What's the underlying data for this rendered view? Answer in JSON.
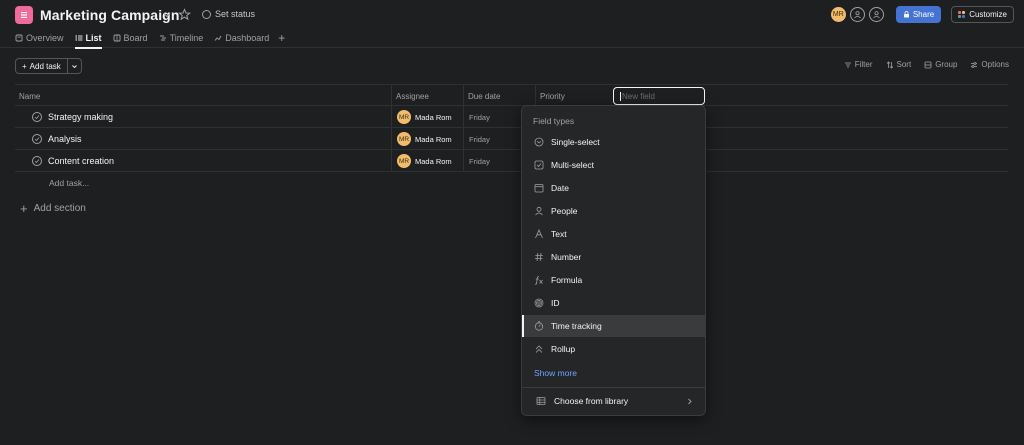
{
  "project": {
    "title": "Marketing Campaign",
    "set_status": "Set status",
    "icon": "list-icon",
    "icon_color": "#f06a9a"
  },
  "tabs": [
    {
      "label": "Overview",
      "icon": "overview-icon"
    },
    {
      "label": "List",
      "icon": "list-icon",
      "active": true
    },
    {
      "label": "Board",
      "icon": "board-icon"
    },
    {
      "label": "Timeline",
      "icon": "timeline-icon"
    },
    {
      "label": "Dashboard",
      "icon": "dashboard-icon"
    }
  ],
  "header_right": {
    "avatar_initials": "MR",
    "share_label": "Share",
    "customize_label": "Customize",
    "accent": "#4573d2"
  },
  "toolbar": {
    "add_task_label": "Add task",
    "filter_label": "Filter",
    "sort_label": "Sort",
    "group_label": "Group",
    "options_label": "Options"
  },
  "table": {
    "columns": [
      "Name",
      "Assignee",
      "Due date",
      "Priority"
    ],
    "new_field_placeholder": "New field",
    "rows": [
      {
        "name": "Strategy making",
        "assignee_initials": "MR",
        "assignee": "Mada Rom",
        "due": "Friday"
      },
      {
        "name": "Analysis",
        "assignee_initials": "MR",
        "assignee": "Mada Rom",
        "due": "Friday"
      },
      {
        "name": "Content creation",
        "assignee_initials": "MR",
        "assignee": "Mada Rom",
        "due": "Friday"
      }
    ],
    "add_task_inline": "Add task...",
    "add_section": "Add section"
  },
  "field_menu": {
    "title": "Field types",
    "items": [
      {
        "label": "Single-select",
        "icon": "single-select-icon"
      },
      {
        "label": "Multi-select",
        "icon": "multi-select-icon"
      },
      {
        "label": "Date",
        "icon": "calendar-icon"
      },
      {
        "label": "People",
        "icon": "person-icon"
      },
      {
        "label": "Text",
        "icon": "text-icon"
      },
      {
        "label": "Number",
        "icon": "hash-icon"
      },
      {
        "label": "Formula",
        "icon": "formula-icon"
      },
      {
        "label": "ID",
        "icon": "fingerprint-icon"
      },
      {
        "label": "Time tracking",
        "icon": "stopwatch-icon",
        "hovered": true
      },
      {
        "label": "Rollup",
        "icon": "rollup-icon"
      }
    ],
    "show_more": "Show more",
    "library_label": "Choose from library",
    "link_color": "#6fa3ff"
  }
}
